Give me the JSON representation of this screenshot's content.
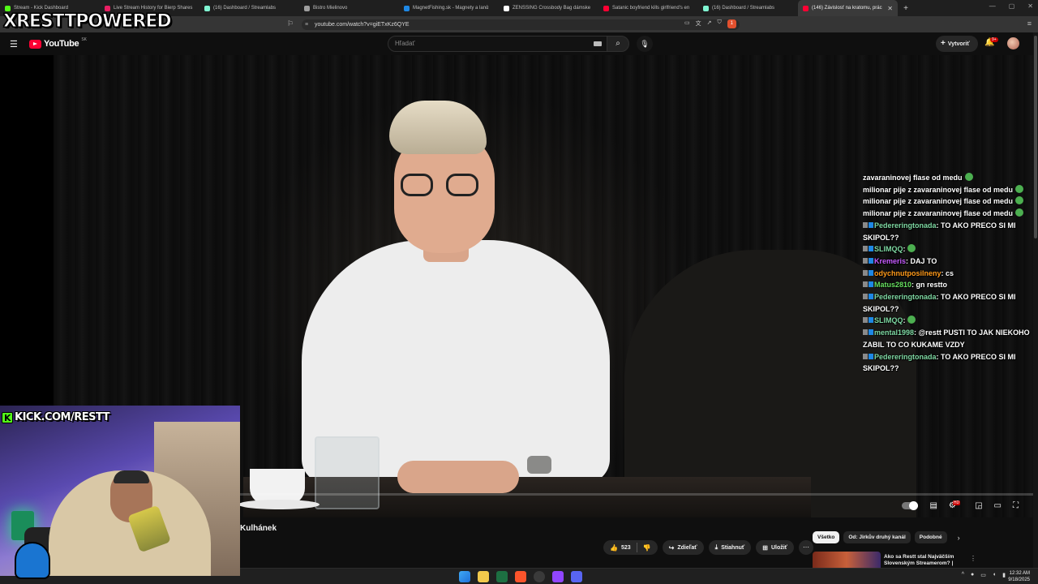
{
  "browser": {
    "tabs": [
      {
        "label": "Stream - Kick Dashboard",
        "color": "#53fc18",
        "active": false
      },
      {
        "label": "Live Stream History for Bierp Shares",
        "color": "#e91e63",
        "active": false
      },
      {
        "label": "(16) Dashboard / Streamlabs",
        "color": "#80f5d2",
        "active": false
      },
      {
        "label": "Bistro Mielinovo",
        "color": "#9e9e9e",
        "active": false
      },
      {
        "label": "MagnetFishing.sk - Magnety a lanά",
        "color": "#1e88e5",
        "active": false
      },
      {
        "label": "ZENSSING Crossbody Bag dámske",
        "color": "#ffffff",
        "active": false
      },
      {
        "label": "Satanic boyfriend kills girlfriend's en",
        "color": "#ff0033",
        "active": false
      },
      {
        "label": "(16) Dashboard / Streamlabs",
        "color": "#80f5d2",
        "active": false
      },
      {
        "label": "(146) Závislosť na kratomu, prác",
        "color": "#ff0033",
        "active": true
      }
    ],
    "new_tab": "+",
    "url": "youtube.com/watch?v=giETxKz6QYE",
    "brave_badge": "1"
  },
  "youtube": {
    "logo_text": "YouTube",
    "country": "SK",
    "search_placeholder": "Hľadať",
    "create_label": "Vytvoriť",
    "notif_count": "9+"
  },
  "chat": [
    {
      "text": "zavaraninovej flase od medu",
      "emote": true
    },
    {
      "text": "milionar pije z zavaraninovej flase od medu",
      "emote": true
    },
    {
      "text": "milionar pije z zavaraninovej flase od medu",
      "emote": true
    },
    {
      "text": "milionar pije z zavaraninovej flase od medu",
      "emote": true
    },
    {
      "user": "Pedereringtonada",
      "color": "#7ed8a2",
      "msg": "TO AKO PRECO SI MI SKIPOL??"
    },
    {
      "user": "SLIMQQ",
      "color": "#7ed8a2",
      "msg": ""
    },
    {
      "user": "Kremeris",
      "color": "#c65bff",
      "msg": "DAJ TO"
    },
    {
      "user": "odychnutposilneny",
      "color": "#ff9a1a",
      "msg": "cs"
    },
    {
      "user": "Matus2810",
      "color": "#67e060",
      "msg": "gn restto"
    },
    {
      "user": "Pedereringtonada",
      "color": "#7ed8a2",
      "msg": "TO AKO PRECO SI MI SKIPOL??"
    },
    {
      "user": "SLIMQQ",
      "color": "#7ed8a2",
      "msg": ""
    },
    {
      "user": "mental1998",
      "color": "#7ed8a2",
      "msg": "@restt PUSTI TO JAK NIEKOHO ZABIL TO CO KUKAME VZDY"
    },
    {
      "user": "Pedereringtonada",
      "color": "#7ed8a2",
      "msg": "TO AKO PRECO SI MI SKIPOL??"
    }
  ],
  "video": {
    "title": "Kulhánek",
    "progress": 0
  },
  "actions": {
    "likes": "523",
    "share": "Zdieľať",
    "download": "Stiahnuť",
    "save": "Uložiť"
  },
  "chips": [
    {
      "label": "Všetko",
      "active": true
    },
    {
      "label": "Od: Jirkův druhý kanál",
      "active": false
    },
    {
      "label": "Podobné",
      "active": false
    }
  ],
  "recommendation": {
    "title": "Ako sa Restt stal Najväčším Slovenským Streamerom? |"
  },
  "taskbar": {
    "time": "12:32 AM",
    "date": "9/18/2025"
  },
  "overlay": {
    "brand": "XRESTTPOWERED",
    "kick_url": "KICK.COM/RESTT",
    "kick_letter": "K"
  }
}
